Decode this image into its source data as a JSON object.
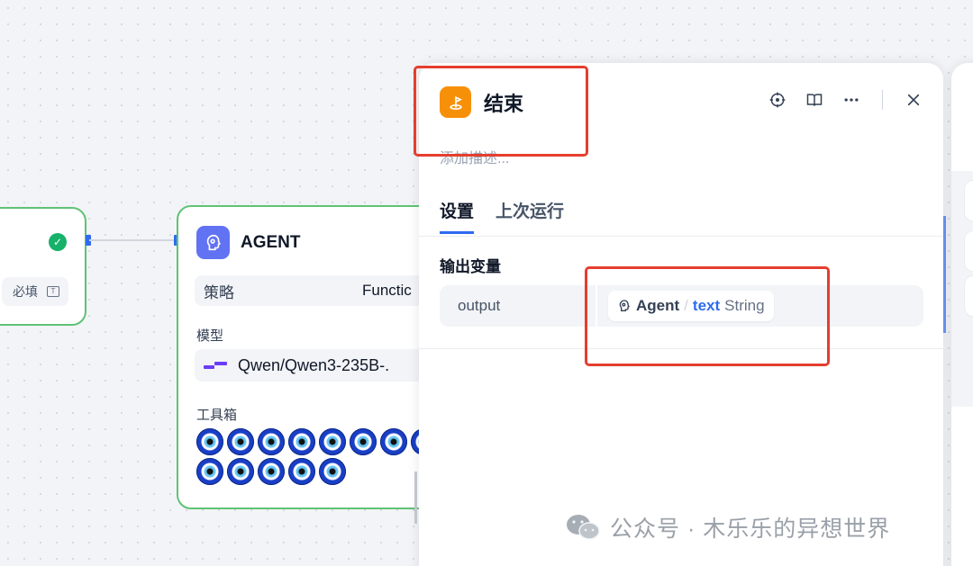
{
  "canvas": {
    "prev_node": {
      "required_label": "必填"
    },
    "agent_node": {
      "title": "AGENT",
      "strategy_label": "策略",
      "strategy_value": "Functic",
      "model_label": "模型",
      "model_name": "Qwen/Qwen3-235B-.",
      "toolbox_label": "工具箱",
      "tool_count": 13
    }
  },
  "panel": {
    "title": "结束",
    "description_placeholder": "添加描述...",
    "tabs": [
      {
        "label": "设置",
        "active": true
      },
      {
        "label": "上次运行",
        "active": false
      }
    ],
    "output_section_label": "输出变量",
    "outputs": [
      {
        "name": "output",
        "source_node": "Agent",
        "separator": "/",
        "variable": "text",
        "type": "String"
      }
    ],
    "toolbar_icons": [
      "locate-icon",
      "book-icon",
      "more-icon",
      "close-icon"
    ]
  },
  "watermark": {
    "text": "公众号 · 木乐乐的异想世界"
  },
  "colors": {
    "accent": "#2e6bf0",
    "node_border": "#5fc275",
    "end_badge": "#f79009",
    "agent_badge": "#6172f3",
    "highlight": "#e53e2e"
  }
}
